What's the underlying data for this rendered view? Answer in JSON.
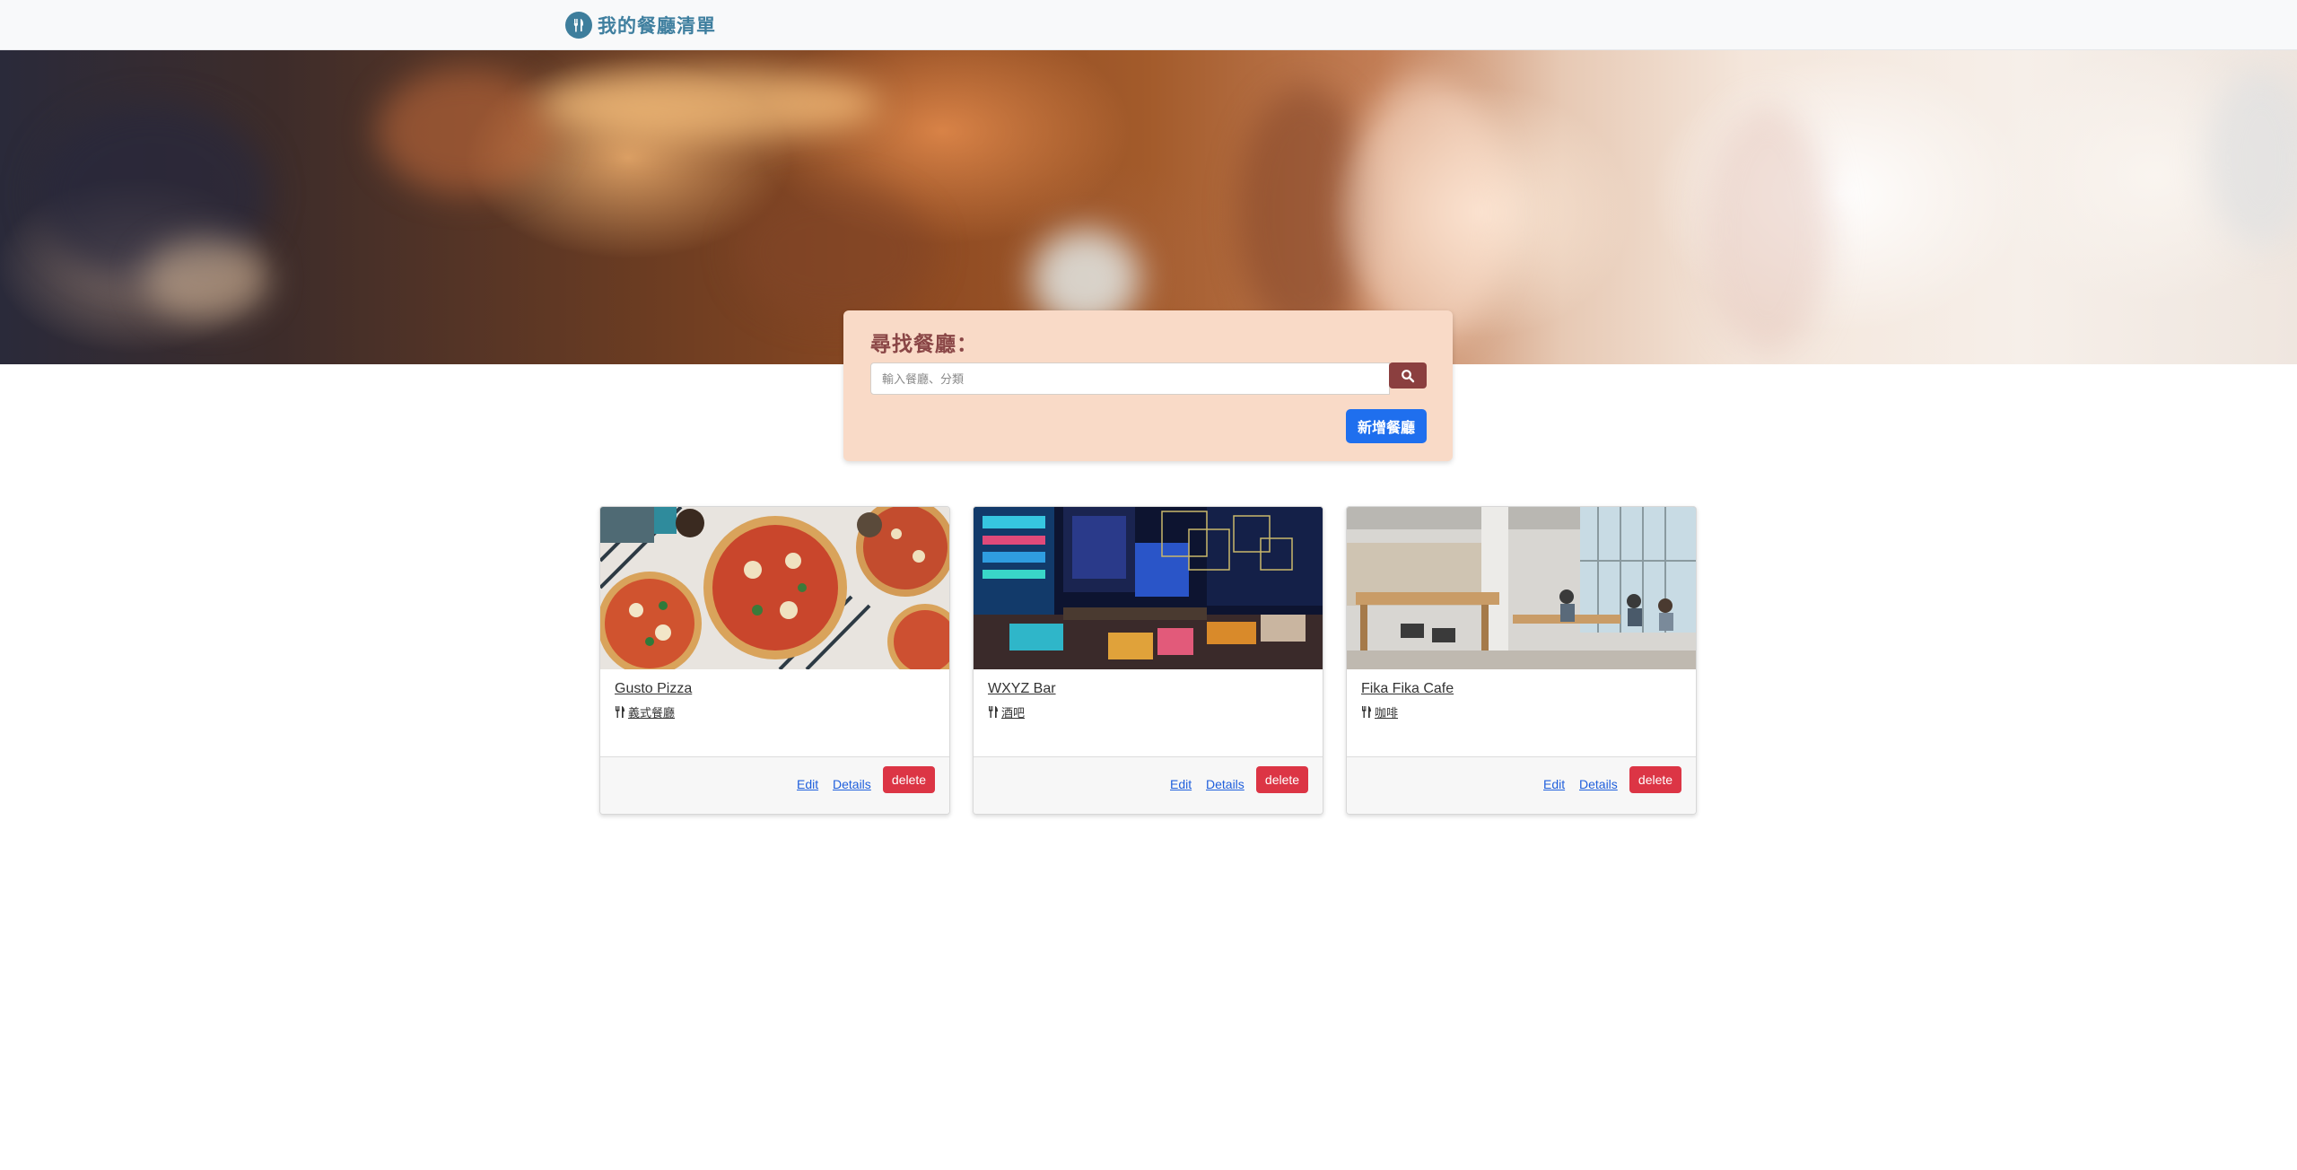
{
  "navbar": {
    "brand_label": "我的餐廳清單",
    "brand_icon": "fork-knife-icon"
  },
  "banner": {
    "description_icon": "blurred-restaurant-photo"
  },
  "search": {
    "title": "尋找餐廳：",
    "placeholder": "輸入餐廳、分類",
    "value": "",
    "button_icon": "search-icon",
    "add_label": "新增餐廳"
  },
  "restaurants": [
    {
      "name": "Gusto Pizza",
      "category": "義式餐廳",
      "category_icon": "utensils-icon",
      "edit_label": "Edit",
      "details_label": "Details",
      "delete_label": "delete"
    },
    {
      "name": "WXYZ Bar",
      "category": "酒吧",
      "category_icon": "utensils-icon",
      "edit_label": "Edit",
      "details_label": "Details",
      "delete_label": "delete"
    },
    {
      "name": "Fika Fika Cafe",
      "category": "咖啡",
      "category_icon": "utensils-icon",
      "edit_label": "Edit",
      "details_label": "Details",
      "delete_label": "delete"
    }
  ],
  "colors": {
    "navbar_bg": "#f8f9fa",
    "brand": "#3f7f9f",
    "search_panel_bg": "#f9dac7",
    "search_title": "#8a4646",
    "search_button": "#8b3f3f",
    "add_button": "#1f6fee",
    "delete_button": "#dc3545",
    "link": "#1f5fdc"
  }
}
